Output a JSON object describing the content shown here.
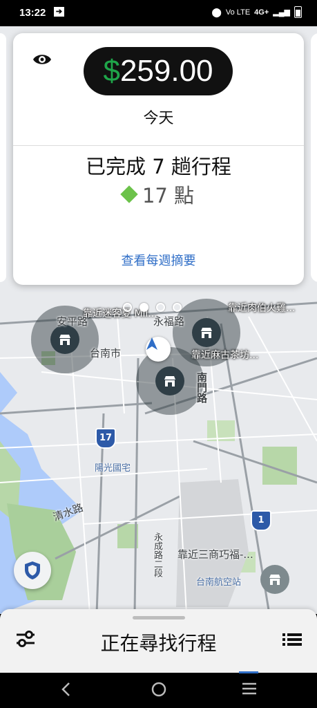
{
  "status_bar": {
    "time": "13:22",
    "network": "4G+",
    "volte": "Vo LTE"
  },
  "earnings_card": {
    "currency_symbol": "$",
    "amount": "259.00",
    "period": "今天",
    "trips_summary": "已完成 7 趟行程",
    "points": "17 點",
    "weekly_link": "查看每週摘要",
    "pages": 4,
    "active_page": 1
  },
  "map": {
    "labels": {
      "anping": "安平路",
      "tainan_city": "台南市",
      "yongfu": "永福路",
      "nanmen": "南門路",
      "yangguang": "陽光國宅",
      "qingshui": "清水路",
      "yongcheng": "永成路二段",
      "airport": "台南航空站"
    },
    "stores": [
      "靠近迷客夏 Mil...",
      "靠近肉伯火雞...",
      "靠近麻古茶坊...",
      "靠近三商巧福-..."
    ],
    "route_shields": [
      "17",
      "1"
    ]
  },
  "bottom_sheet": {
    "status": "正在尋找行程"
  },
  "colors": {
    "earnings_green": "#1fa64a",
    "link_blue": "#2f6ec7",
    "points_diamond": "#6cc24a"
  }
}
